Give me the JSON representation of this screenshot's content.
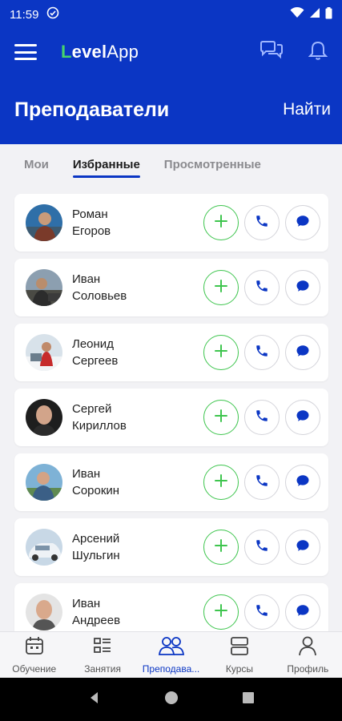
{
  "status_bar": {
    "time": "11:59"
  },
  "app_bar": {
    "logo_l": "L",
    "logo_level": "evel",
    "logo_app": "App"
  },
  "header": {
    "title": "Преподаватели",
    "find_label": "Найти"
  },
  "tabs": [
    {
      "label": "Мои",
      "active": false
    },
    {
      "label": "Избранные",
      "active": true
    },
    {
      "label": "Просмотренные",
      "active": false
    }
  ],
  "teachers": [
    {
      "first": "Роман",
      "last": "Егоров"
    },
    {
      "first": "Иван",
      "last": "Соловьев"
    },
    {
      "first": "Леонид",
      "last": "Сергеев"
    },
    {
      "first": "Сергей",
      "last": "Кириллов"
    },
    {
      "first": "Иван",
      "last": "Сорокин"
    },
    {
      "first": "Арсений",
      "last": "Шульгин"
    },
    {
      "first": "Иван",
      "last": "Андреев"
    }
  ],
  "bottom_nav": [
    {
      "label": "Обучение",
      "icon": "calendar-icon",
      "active": false
    },
    {
      "label": "Занятия",
      "icon": "list-icon",
      "active": false
    },
    {
      "label": "Преподава...",
      "icon": "people-icon",
      "active": true
    },
    {
      "label": "Курсы",
      "icon": "layers-icon",
      "active": false
    },
    {
      "label": "Профиль",
      "icon": "profile-icon",
      "active": false
    }
  ],
  "colors": {
    "brand": "#0b36c4",
    "accent_green": "#3ec54e",
    "background": "#f2f2f5"
  }
}
